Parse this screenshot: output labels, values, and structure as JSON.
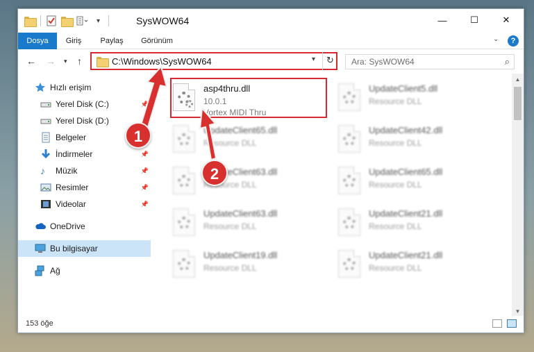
{
  "window": {
    "title": "SysWOW64",
    "controls": {
      "minimize": "—",
      "maximize": "☐",
      "close": "✕"
    }
  },
  "ribbon": {
    "tabs": [
      "Dosya",
      "Giriş",
      "Paylaş",
      "Görünüm"
    ],
    "help": "?"
  },
  "nav": {
    "address": "C:\\Windows\\SysWOW64",
    "search_placeholder": "Ara: SysWOW64"
  },
  "sidebar": {
    "items": [
      {
        "label": "Hızlı erişim",
        "icon": "star-icon"
      },
      {
        "label": "Yerel Disk (C:)",
        "icon": "drive-icon"
      },
      {
        "label": "Yerel Disk (D:)",
        "icon": "drive-icon"
      },
      {
        "label": "Belgeler",
        "icon": "documents-icon"
      },
      {
        "label": "İndirmeler",
        "icon": "download-icon"
      },
      {
        "label": "Müzik",
        "icon": "music-icon"
      },
      {
        "label": "Resimler",
        "icon": "pictures-icon"
      },
      {
        "label": "Videolar",
        "icon": "video-icon"
      },
      {
        "label": "OneDrive",
        "icon": "cloud-icon"
      },
      {
        "label": "Bu bilgisayar",
        "icon": "computer-icon"
      },
      {
        "label": "Ağ",
        "icon": "network-icon"
      }
    ]
  },
  "files": {
    "highlighted": {
      "name": "asp4thru.dll",
      "version": "10.0.1",
      "description": "Vortex MIDI Thru"
    },
    "blurred": [
      {
        "name": "UpdateClient5.dll",
        "type": "Resource DLL"
      },
      {
        "name": "UpdateClient65.dll",
        "type": "Resource DLL"
      },
      {
        "name": "UpdateClient42.dll",
        "type": "Resource DLL"
      },
      {
        "name": "UpdateClient63.dll",
        "type": "Resource DLL"
      },
      {
        "name": "UpdateClient65.dll",
        "type": "Resource DLL"
      },
      {
        "name": "UpdateClient63.dll",
        "type": "Resource DLL"
      },
      {
        "name": "UpdateClient21.dll",
        "type": "Resource DLL"
      },
      {
        "name": "UpdateClient19.dll",
        "type": "Resource DLL"
      },
      {
        "name": "UpdateClient21.dll",
        "type": "Resource DLL"
      }
    ]
  },
  "status": {
    "count": "153 öğe"
  },
  "annotations": {
    "badge1": "1",
    "badge2": "2",
    "color": "#d8302e"
  }
}
